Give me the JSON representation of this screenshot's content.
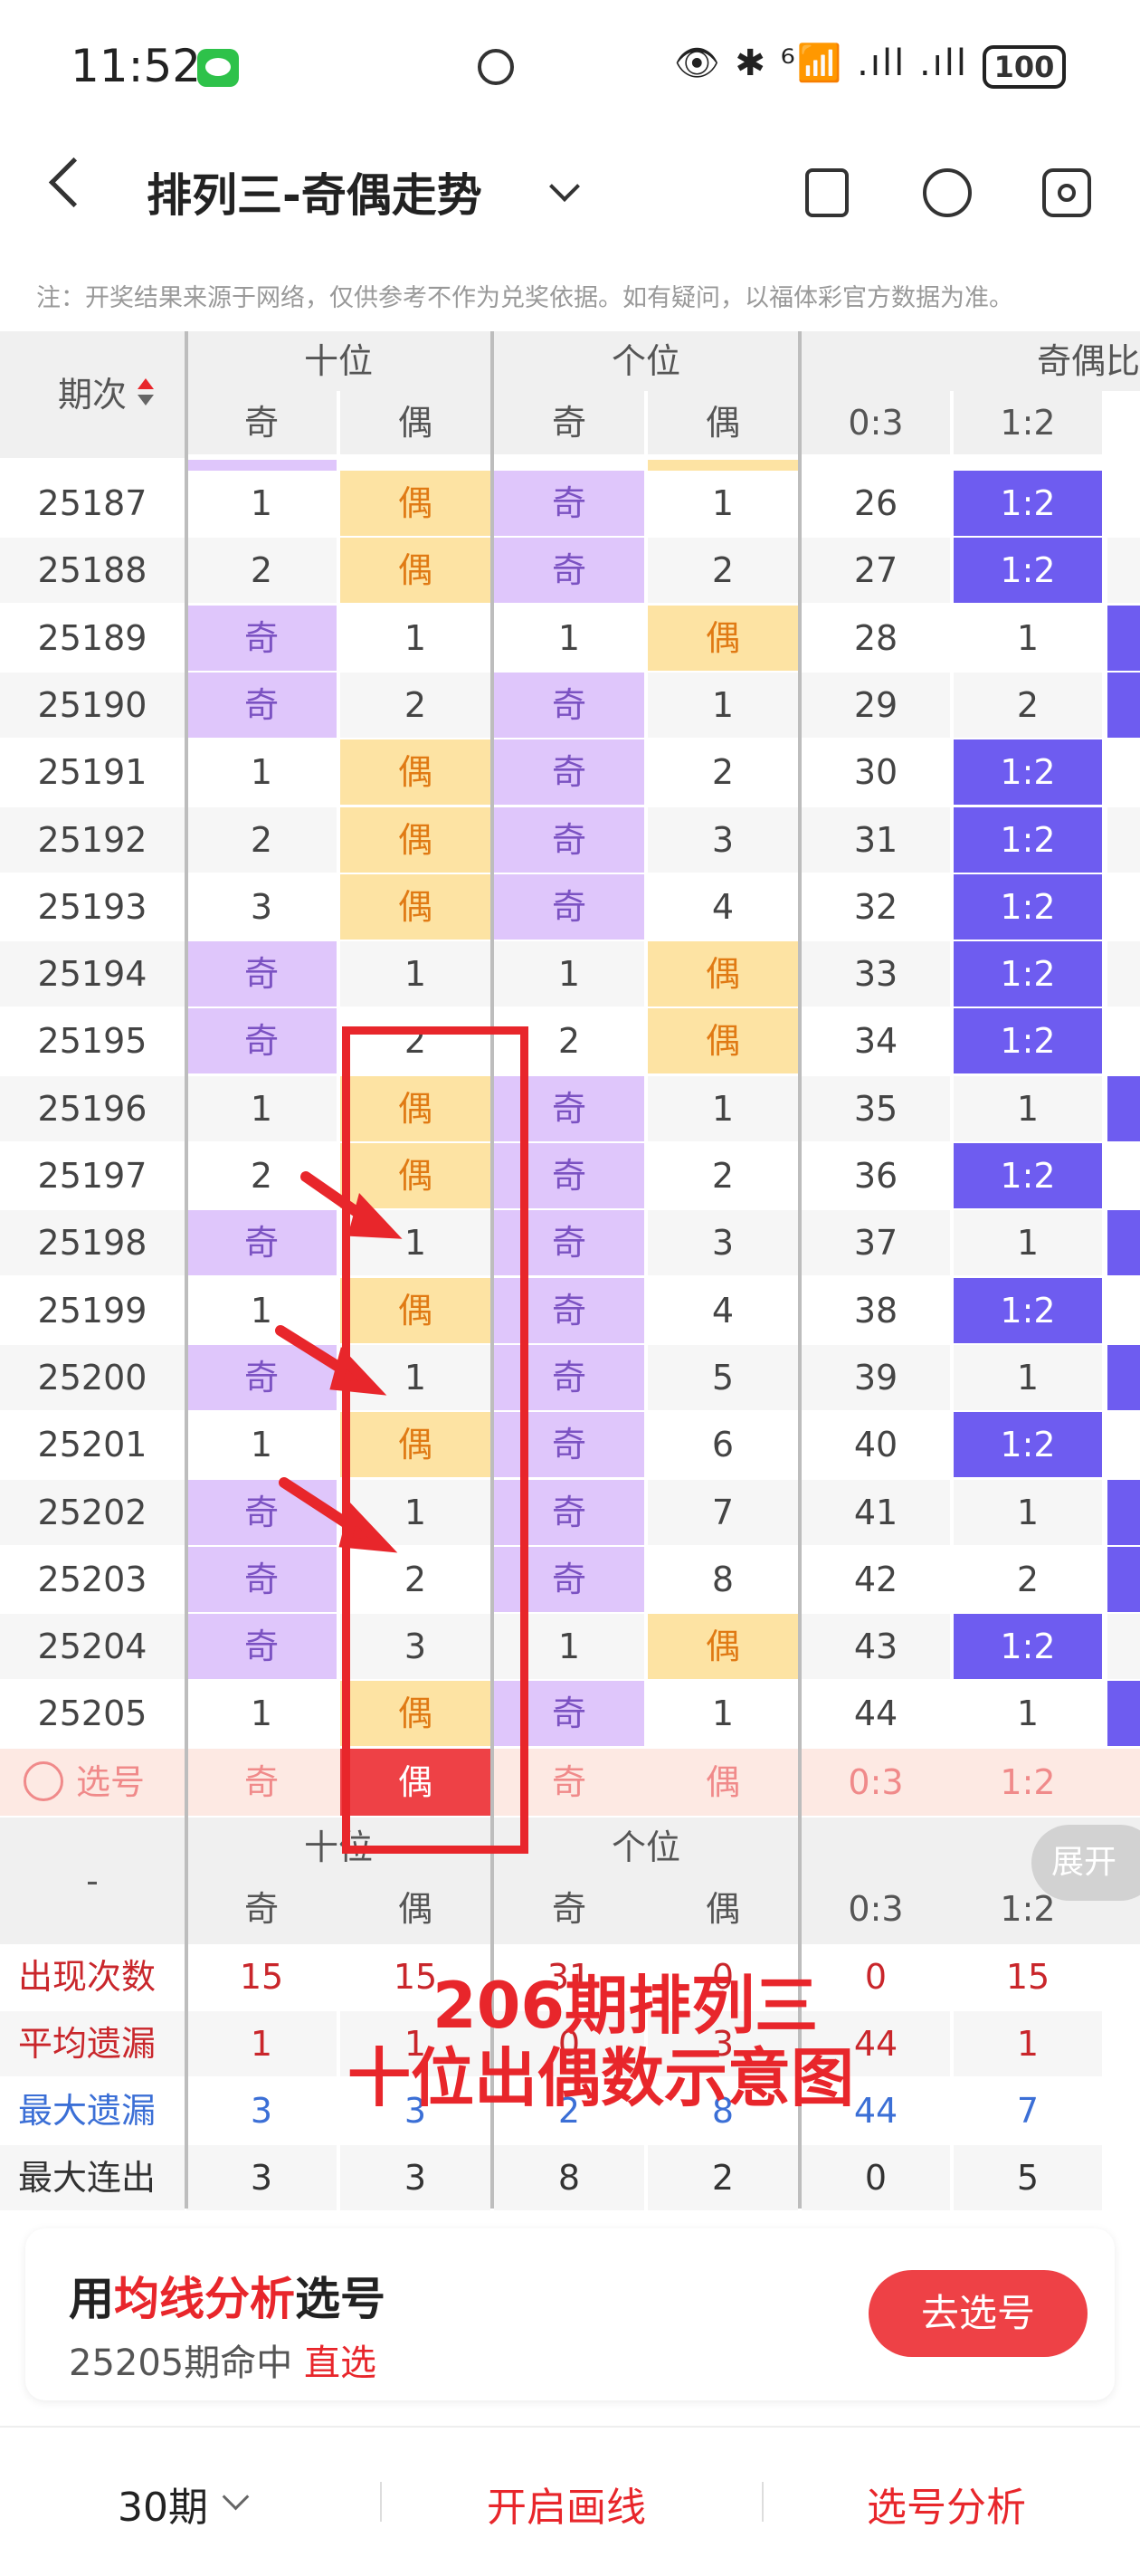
{
  "status": {
    "time": "11:52",
    "right": "👁 ✱ ⁶📶 .ıll .ıll",
    "battery": "100"
  },
  "header": {
    "title": "排列三-奇偶走势"
  },
  "note": "注：开奖结果来源于网络，仅供参考不作为兑奖依据。如有疑问，以福体彩官方数据为准。",
  "table": {
    "col_period": "期次",
    "groups": [
      "十位",
      "个位",
      "奇偶比"
    ],
    "subs": [
      "奇",
      "偶",
      "奇",
      "偶",
      "0:3",
      "1:2"
    ],
    "rows": [
      {
        "p": "25187",
        "a": "1",
        "b": "偶",
        "c": "奇",
        "d": "1",
        "e": "26",
        "f": "1:2",
        "ab": "even",
        "cd": "odd",
        "fh": true
      },
      {
        "p": "25188",
        "a": "2",
        "b": "偶",
        "c": "奇",
        "d": "2",
        "e": "27",
        "f": "1:2",
        "ab": "even",
        "cd": "odd",
        "fh": true
      },
      {
        "p": "25189",
        "a": "奇",
        "b": "1",
        "c": "1",
        "d": "偶",
        "e": "28",
        "f": "1",
        "ab": "odd",
        "cd": "even",
        "fh": false
      },
      {
        "p": "25190",
        "a": "奇",
        "b": "2",
        "c": "奇",
        "d": "1",
        "e": "29",
        "f": "2",
        "ab": "odd",
        "cd": "odd",
        "fh": false
      },
      {
        "p": "25191",
        "a": "1",
        "b": "偶",
        "c": "奇",
        "d": "2",
        "e": "30",
        "f": "1:2",
        "ab": "even",
        "cd": "odd",
        "fh": true
      },
      {
        "p": "25192",
        "a": "2",
        "b": "偶",
        "c": "奇",
        "d": "3",
        "e": "31",
        "f": "1:2",
        "ab": "even",
        "cd": "odd",
        "fh": true
      },
      {
        "p": "25193",
        "a": "3",
        "b": "偶",
        "c": "奇",
        "d": "4",
        "e": "32",
        "f": "1:2",
        "ab": "even",
        "cd": "odd",
        "fh": true
      },
      {
        "p": "25194",
        "a": "奇",
        "b": "1",
        "c": "1",
        "d": "偶",
        "e": "33",
        "f": "1:2",
        "ab": "odd",
        "cd": "even",
        "fh": true
      },
      {
        "p": "25195",
        "a": "奇",
        "b": "2",
        "c": "2",
        "d": "偶",
        "e": "34",
        "f": "1:2",
        "ab": "odd",
        "cd": "even",
        "fh": true
      },
      {
        "p": "25196",
        "a": "1",
        "b": "偶",
        "c": "奇",
        "d": "1",
        "e": "35",
        "f": "1",
        "ab": "even",
        "cd": "odd",
        "fh": false
      },
      {
        "p": "25197",
        "a": "2",
        "b": "偶",
        "c": "奇",
        "d": "2",
        "e": "36",
        "f": "1:2",
        "ab": "even",
        "cd": "odd",
        "fh": true
      },
      {
        "p": "25198",
        "a": "奇",
        "b": "1",
        "c": "奇",
        "d": "3",
        "e": "37",
        "f": "1",
        "ab": "odd",
        "cd": "odd",
        "fh": false
      },
      {
        "p": "25199",
        "a": "1",
        "b": "偶",
        "c": "奇",
        "d": "4",
        "e": "38",
        "f": "1:2",
        "ab": "even",
        "cd": "odd",
        "fh": true
      },
      {
        "p": "25200",
        "a": "奇",
        "b": "1",
        "c": "奇",
        "d": "5",
        "e": "39",
        "f": "1",
        "ab": "odd",
        "cd": "odd",
        "fh": false
      },
      {
        "p": "25201",
        "a": "1",
        "b": "偶",
        "c": "奇",
        "d": "6",
        "e": "40",
        "f": "1:2",
        "ab": "even",
        "cd": "odd",
        "fh": true
      },
      {
        "p": "25202",
        "a": "奇",
        "b": "1",
        "c": "奇",
        "d": "7",
        "e": "41",
        "f": "1",
        "ab": "odd",
        "cd": "odd",
        "fh": false
      },
      {
        "p": "25203",
        "a": "奇",
        "b": "2",
        "c": "奇",
        "d": "8",
        "e": "42",
        "f": "2",
        "ab": "odd",
        "cd": "odd",
        "fh": false
      },
      {
        "p": "25204",
        "a": "奇",
        "b": "3",
        "c": "1",
        "d": "偶",
        "e": "43",
        "f": "1:2",
        "ab": "odd",
        "cd": "even",
        "fh": true
      },
      {
        "p": "25205",
        "a": "1",
        "b": "偶",
        "c": "奇",
        "d": "1",
        "e": "44",
        "f": "1",
        "ab": "even",
        "cd": "odd",
        "fh": false
      }
    ],
    "select_row": {
      "label": "选号",
      "a": "奇",
      "b": "偶",
      "c": "奇",
      "d": "偶",
      "e": "0:3",
      "f": "1:2"
    },
    "summary_groups": [
      "十位",
      "个位",
      "奇偶比"
    ],
    "summary_dash": "-",
    "expand": "展开",
    "stats": [
      {
        "label": "出现次数",
        "vals": [
          "15",
          "15",
          "31",
          "0",
          "0",
          "15"
        ],
        "color": "#c9262b"
      },
      {
        "label": "平均遗漏",
        "vals": [
          "1",
          "1",
          "0",
          "3",
          "44",
          "1"
        ],
        "color": "#c9262b"
      },
      {
        "label": "最大遗漏",
        "vals": [
          "3",
          "3",
          "2",
          "8",
          "44",
          "7"
        ],
        "color": "#3b6fd6"
      },
      {
        "label": "最大连出",
        "vals": [
          "3",
          "3",
          "8",
          "2",
          "0",
          "5"
        ],
        "color": "#333"
      }
    ]
  },
  "annotation": {
    "line1": "206期排列三",
    "line2": "十位出偶数示意图"
  },
  "card": {
    "title_pre": "用",
    "title_hl": "均线分析",
    "title_post": "选号",
    "sub": "25205期命中",
    "sub_hl": "直选",
    "button": "去选号"
  },
  "bottom": {
    "periods": "30期",
    "draw": "开启画线",
    "analysis": "选号分析"
  },
  "colors": {
    "odd": "#dfc6fb",
    "even": "#fde3a3",
    "ratio": "#6e5cf0",
    "accent": "#e8262b"
  }
}
